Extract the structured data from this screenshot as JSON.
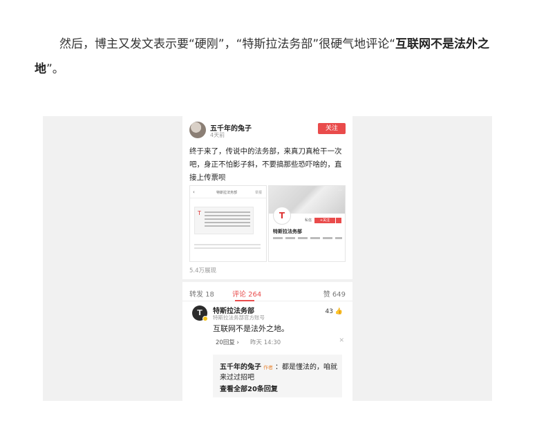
{
  "article": {
    "text": "然后，博主又发文表示要“硬刚”，“特斯拉法务部”很硬气地评论“",
    "bold": "互联网不是法外之地",
    "tail": "”。"
  },
  "post": {
    "user": "五千年的兔子",
    "time": "4天前",
    "follow_label": "关注",
    "text": "终于来了，传说中的法务部，来真刀真枪干一次吧，身正不怕影子斜，不要搞那些恐吓啥的，直接上传票呗",
    "shot_left": {
      "back": "‹",
      "title": "特斯拉法务部",
      "action": "举报"
    },
    "shot_right": {
      "name": "特斯拉法务部",
      "chat": "私信",
      "follow": "+关注"
    },
    "views": "5.4万展现"
  },
  "tabs": {
    "repost": "转发 18",
    "comments": "评论 264",
    "likes": "赞 649"
  },
  "comment": {
    "avatar_mark": "T",
    "name": "特斯拉法务部",
    "verified": "特斯拉法务部官方账号",
    "likes": "43 👍",
    "text": "互联网不是法外之地。",
    "replies_label": "20回复 ›",
    "date": "昨天 14:30",
    "close": "✕"
  },
  "reply": {
    "user": "五千年的兔子",
    "tag": "作者",
    "text_line1": "：都是懂法的，咱就",
    "text_line2": "来过过招吧",
    "view_all": "查看全部20条回复"
  },
  "colors": {
    "accent": "#e94b4b",
    "badge": "#f4c21a"
  },
  "icons": [
    "avatar-icon",
    "tesla-logo-icon",
    "thumbs-up-icon",
    "close-icon",
    "chevron-right-icon"
  ]
}
